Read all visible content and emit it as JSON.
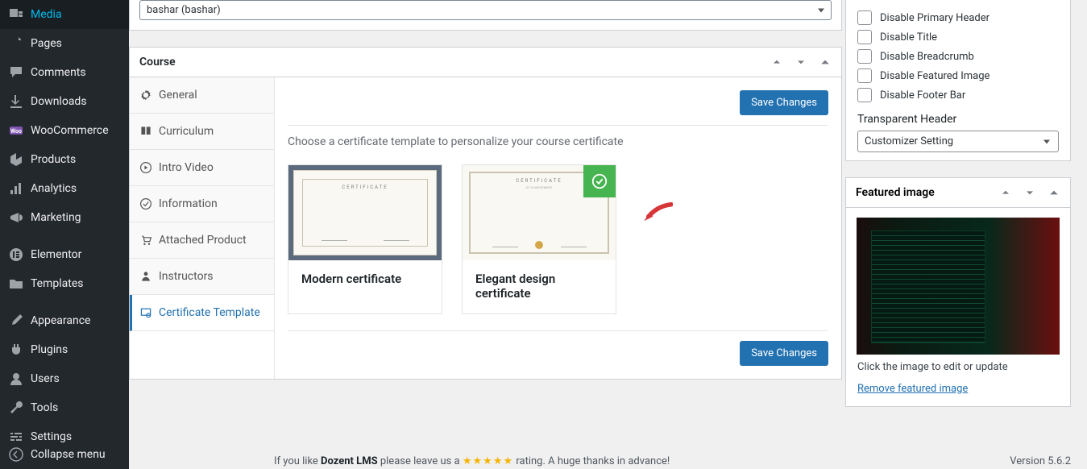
{
  "sidebar": {
    "items": [
      {
        "label": "Media"
      },
      {
        "label": "Pages"
      },
      {
        "label": "Comments"
      },
      {
        "label": "Downloads"
      },
      {
        "label": "WooCommerce"
      },
      {
        "label": "Products"
      },
      {
        "label": "Analytics"
      },
      {
        "label": "Marketing"
      },
      {
        "label": "Elementor"
      },
      {
        "label": "Templates"
      },
      {
        "label": "Appearance"
      },
      {
        "label": "Plugins"
      },
      {
        "label": "Users"
      },
      {
        "label": "Tools"
      },
      {
        "label": "Settings"
      }
    ],
    "collapse": "Collapse menu"
  },
  "author_select": "bashar (bashar)",
  "course_panel": {
    "title": "Course",
    "tabs": {
      "general": "General",
      "curriculum": "Curriculum",
      "intro_video": "Intro Video",
      "information": "Information",
      "attached_product": "Attached Product",
      "instructors": "Instructors",
      "certificate_template": "Certificate Template"
    },
    "save_btn": "Save Changes",
    "help_text": "Choose a certificate template to personalize your course certificate",
    "cards": [
      {
        "label": "Modern certificate",
        "selected": false
      },
      {
        "label": "Elegant design certificate",
        "selected": true
      }
    ]
  },
  "astra_panel": {
    "checkboxes": [
      "Disable Primary Header",
      "Disable Title",
      "Disable Breadcrumb",
      "Disable Featured Image",
      "Disable Footer Bar"
    ],
    "transparent_label": "Transparent Header",
    "transparent_select": "Customizer Setting"
  },
  "featured_panel": {
    "title": "Featured image",
    "help": "Click the image to edit or update",
    "remove_link": "Remove featured image"
  },
  "footer": {
    "prefix": "If you like ",
    "product": "Dozent LMS",
    "mid": " please leave us a ",
    "suffix": " rating. A huge thanks in advance!",
    "version": "Version 5.6.2"
  },
  "cert_mock": {
    "title": "CERTIFICATE",
    "sub": "OF ACHIEVEMENT"
  }
}
